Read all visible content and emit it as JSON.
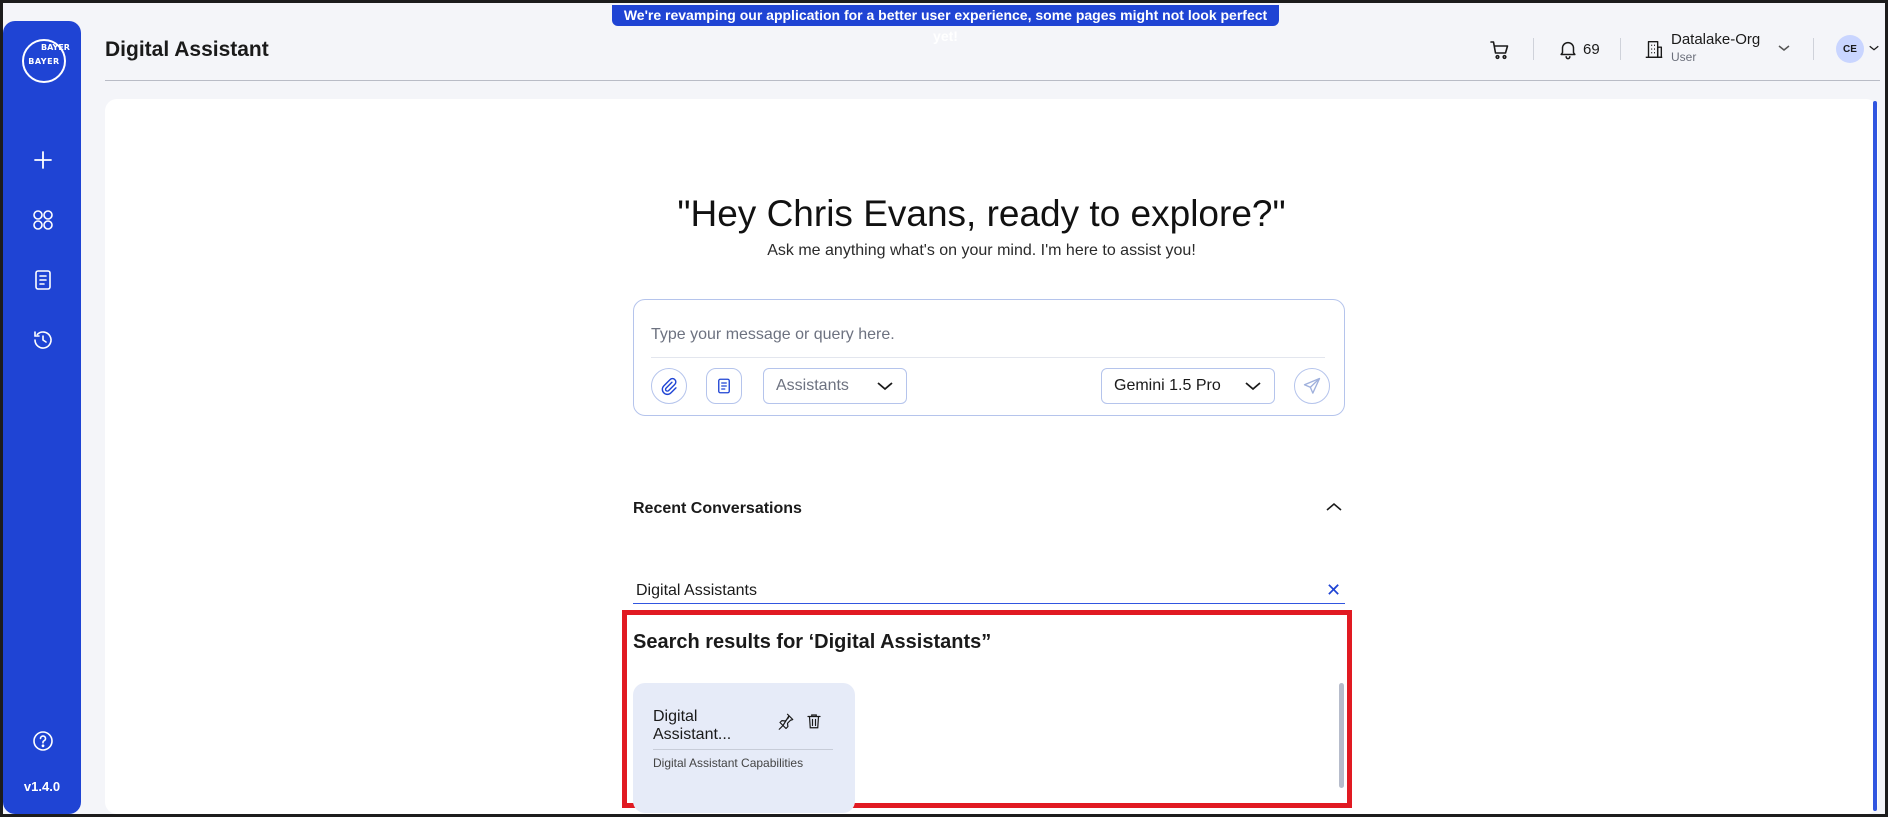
{
  "banner": {
    "text": "We're revamping our application for a better user experience, some pages might not look perfect yet!"
  },
  "sidebar": {
    "logo": {
      "horizontal": "BAYER",
      "vertical": "BAYER"
    },
    "items": [
      {
        "icon": "plus-icon"
      },
      {
        "icon": "apps-grid-icon"
      },
      {
        "icon": "notebook-icon"
      },
      {
        "icon": "history-icon"
      }
    ],
    "help_icon": "help-icon",
    "version": "v1.4.0"
  },
  "header": {
    "title": "Digital Assistant",
    "notifications_count": "69",
    "org": {
      "name": "Datalake-Org",
      "role": "User"
    },
    "avatar_initials": "CE"
  },
  "main": {
    "greeting": "\"Hey Chris Evans, ready to explore?\"",
    "subtitle": "Ask me anything what's on your mind. I'm here to assist you!",
    "chat": {
      "placeholder": "Type your message or query here.",
      "value": "",
      "assistants_label": "Assistants",
      "model_label": "Gemini 1.5 Pro"
    },
    "recent": {
      "title": "Recent Conversations",
      "search_value": "Digital Assistants",
      "results_title": "Search results for ‘Digital Assistants”",
      "results": [
        {
          "title": "Digital Assistant...",
          "subtitle": "Digital Assistant Capabilities"
        }
      ]
    }
  },
  "colors": {
    "primary": "#1f44d4",
    "highlight_border": "#e11a22",
    "card_bg": "#e6ebf8"
  }
}
